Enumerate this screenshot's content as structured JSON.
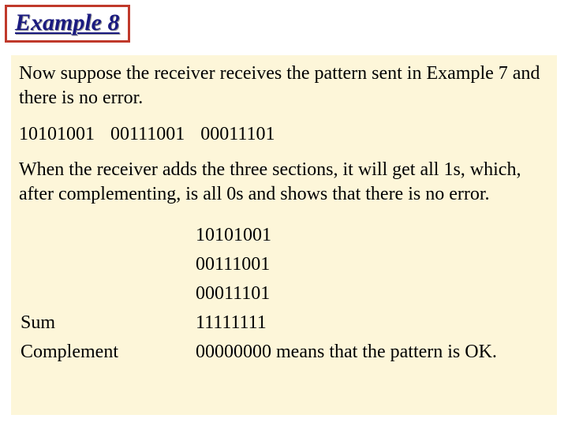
{
  "title": "Example 8",
  "intro": "Now suppose the receiver receives the pattern sent in Example 7 and there is no error.",
  "received_pattern": "10101001   00111001   00011101",
  "explanation": "When the receiver adds the three sections, it will get all 1s, which, after complementing, is all 0s and shows that there is no error.",
  "calc": {
    "rows": [
      {
        "label": "",
        "value": "10101001"
      },
      {
        "label": "",
        "value": "00111001"
      },
      {
        "label": "",
        "value": "00011101"
      },
      {
        "label": "Sum",
        "value": "11111111"
      },
      {
        "label": "Complement",
        "value": "00000000  means that the pattern is OK."
      }
    ]
  }
}
